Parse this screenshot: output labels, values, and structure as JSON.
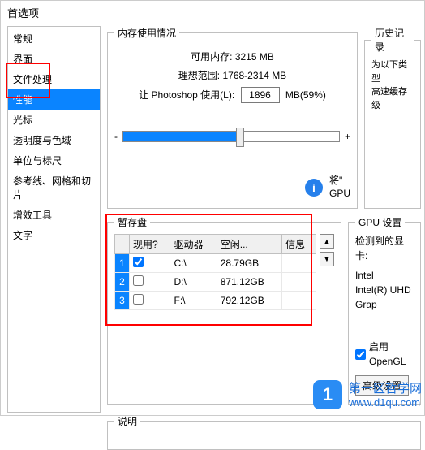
{
  "window": {
    "title": "首选项"
  },
  "sidebar": {
    "items": [
      {
        "label": "常规"
      },
      {
        "label": "界面"
      },
      {
        "label": "文件处理"
      },
      {
        "label": "性能",
        "selected": true
      },
      {
        "label": "光标"
      },
      {
        "label": "透明度与色域"
      },
      {
        "label": "单位与标尺"
      },
      {
        "label": "参考线、网格和切片"
      },
      {
        "label": "增效工具"
      },
      {
        "label": "文字"
      }
    ]
  },
  "memory": {
    "legend": "内存使用情况",
    "available_label": "可用内存:",
    "available_value": "3215 MB",
    "ideal_label": "理想范围:",
    "ideal_value": "1768-2314 MB",
    "let_label": "让 Photoshop 使用(L):",
    "let_value": "1896",
    "let_unit": "MB(59%)",
    "minus": "-",
    "plus": "+"
  },
  "history": {
    "legend": "历史记录",
    "line1": "为以下类型",
    "line2": "高速缓存级"
  },
  "info": {
    "line1": "将\"",
    "line2": "GPU"
  },
  "scratch": {
    "legend": "暂存盘",
    "col_active": "现用?",
    "col_drive": "驱动器",
    "col_free": "空闲...",
    "col_info": "信息",
    "rows": [
      {
        "n": "1",
        "active": true,
        "drive": "C:\\",
        "free": "28.79GB",
        "info": ""
      },
      {
        "n": "2",
        "active": false,
        "drive": "D:\\",
        "free": "871.12GB",
        "info": ""
      },
      {
        "n": "3",
        "active": false,
        "drive": "F:\\",
        "free": "792.12GB",
        "info": ""
      }
    ],
    "up": "▲",
    "down": "▼"
  },
  "gpu": {
    "legend": "GPU 设置",
    "detected_label": "检测到的显卡:",
    "card1": "Intel",
    "card2": "Intel(R) UHD Grap",
    "enable_label": "启用 OpenGL",
    "advanced_btn": "高级设置"
  },
  "desc": {
    "legend": "说明"
  },
  "watermark": {
    "icon": "1",
    "text": "第一区哲学网",
    "url": "www.d1qu.com"
  }
}
